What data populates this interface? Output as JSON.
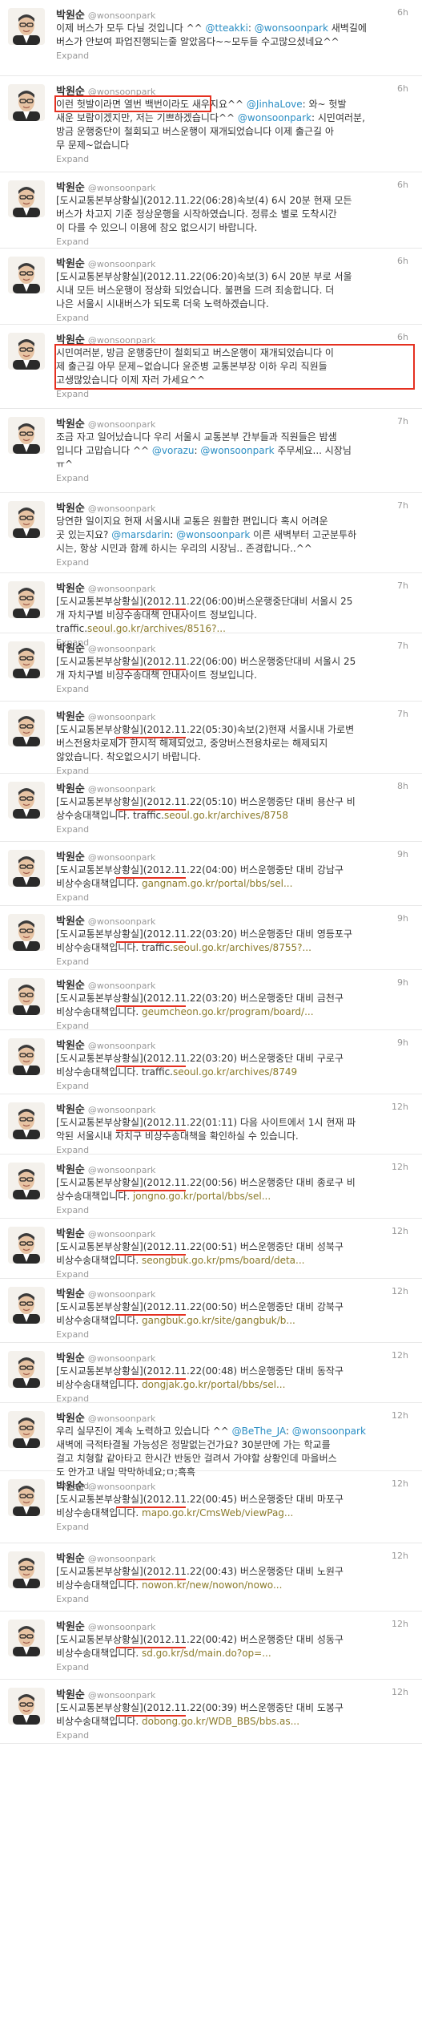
{
  "colors": {
    "link": "#2b8ec4",
    "url": "#8a7a2a",
    "highlight": "#e53020",
    "meta": "#999999"
  },
  "icons": {
    "avatar": "avatar-photo-icon"
  },
  "tweets": [
    {
      "name": "박원순",
      "handle": "@wonsoonpark",
      "time": "6h",
      "text_lines": [
        "이제 버스가 모두 다닐 것입니다 ^^ @tteakki: @wonsoonpark 새벽길에",
        "버스가 안보여 파업진행되는줄 알았음다~~모두들 수고많으셨네요^^"
      ],
      "expand": "Expand"
    },
    {
      "name": "박원순",
      "handle": "@wonsoonpark",
      "time": "6h",
      "text_lines": [
        "이런 헛발이라면 열번 백번이라도 새우지요^^ @JinhaLove: 와~ 헛발",
        "새운 보람이겠지만, 저는 기쁘하겠습니다^^ @wonsoonpark: 시민여러분,",
        "방금 운행중단이 철회되고 버스운행이 재개되었습니다 이제 출근길 아",
        "무 문제~없습니다"
      ],
      "expand": "Expand"
    },
    {
      "name": "박원순",
      "handle": "@wonsoonpark",
      "time": "6h",
      "text_lines": [
        "[도시교통본부상황실](2012.11.22(06:28)속보(4) 6시 20분 현재 모든",
        "버스가 차고지 기준 정상운행을 시작하였습니다. 정류소 별로 도착시간",
        "이 다를 수 있으니 이용에 참오 없으시기 바랍니다."
      ],
      "expand": "Expand"
    },
    {
      "name": "박원순",
      "handle": "@wonsoonpark",
      "time": "6h",
      "text_lines": [
        "[도시교통본부상황실](2012.11.22(06:20)속보(3) 6시 20분 부로 서울",
        "시내 모든 버스운행이 정상화 되었습니다. 불편을 드려 죄송합니다. 더",
        "나은 서울시 시내버스가 되도록 더욱 노력하겠습니다."
      ],
      "expand": "Expand"
    },
    {
      "name": "박원순",
      "handle": "@wonsoonpark",
      "time": "6h",
      "text_lines": [
        "시민여러분, 방금 운행중단이 철회되고 버스운행이 재개되었습니다 이",
        "제 출근길 아무 문제~없습니다 윤준병 교통본부장 이하 우리 직원들",
        "고생많았습니다 이제 자러 가세요^^"
      ],
      "expand": "Expand"
    },
    {
      "name": "박원순",
      "handle": "@wonsoonpark",
      "time": "7h",
      "text_lines": [
        "조금 자고 일어났습니다 우리 서울시 교통본부 간부들과 직원들은 밤샘",
        "입니다 고맙습니다 ^^ @vorazu: @wonsoonpark 주무세요... 시장님",
        "ㅠ^"
      ],
      "expand": "Expand"
    },
    {
      "name": "박원순",
      "handle": "@wonsoonpark",
      "time": "7h",
      "text_lines": [
        "당연한 일이지요 현재 서울시내 교통은 원활한 편입니다 혹시 어려운",
        "곳 있는지요? @marsdarin: @wonsoonpark 이른 새벽부터 고군분투하",
        "시는, 항상 시민과 함께 하시는 우리의 시장님.. 존경합니다..^^"
      ],
      "expand": "Expand"
    },
    {
      "name": "박원순",
      "handle": "@wonsoonpark",
      "time": "7h",
      "text_lines": [
        "[도시교통본부상황실](2012.11.22(06:00)버스운행중단대비 서울시 25",
        "개 자치구별 비상수송대책 안내사이트 정보입니다.",
        "traffic.seoul.go.kr/archives/8516?..."
      ],
      "expand": "Expand"
    },
    {
      "name": "박원순",
      "handle": "@wonsoonpark",
      "time": "7h",
      "text_lines": [
        "[도시교통본부상황실](2012.11.22(06:00) 버스운행중단대비 서울시 25",
        "개 자치구별 비상수송대책 안내사이트 정보입니다."
      ],
      "expand": "Expand"
    },
    {
      "name": "박원순",
      "handle": "@wonsoonpark",
      "time": "7h",
      "text_lines": [
        "[도시교통본부상황실](2012.11.22(05:30)속보(2)현재 서울시내 가로변",
        "버스전용차로제가 한시적 해제되었고, 중앙버스전용차로는 해제되지",
        "않았습니다. 착오없으시기 바랍니다."
      ],
      "expand": "Expand"
    },
    {
      "name": "박원순",
      "handle": "@wonsoonpark",
      "time": "8h",
      "text_lines": [
        "[도시교통본부상황실](2012.11.22(05:10) 버스운행중단 대비 용산구 비",
        "상수송대책입니다. traffic.seoul.go.kr/archives/8758"
      ],
      "expand": "Expand"
    },
    {
      "name": "박원순",
      "handle": "@wonsoonpark",
      "time": "9h",
      "text_lines": [
        "[도시교통본부상황실](2012.11.22(04:00) 버스운행중단 대비 강남구",
        "비상수송대책입니다. gangnam.go.kr/portal/bbs/sel..."
      ],
      "expand": "Expand"
    },
    {
      "name": "박원순",
      "handle": "@wonsoonpark",
      "time": "9h",
      "text_lines": [
        "[도시교통본부상황실](2012.11.22(03:20) 버스운행중단 대비 영등포구",
        "비상수송대책입니다. traffic.seoul.go.kr/archives/8755?..."
      ],
      "expand": "Expand"
    },
    {
      "name": "박원순",
      "handle": "@wonsoonpark",
      "time": "9h",
      "text_lines": [
        "[도시교통본부상황실](2012.11.22(03:20) 버스운행중단 대비 금천구",
        "비상수송대책입니다. geumcheon.go.kr/program/board/..."
      ],
      "expand": "Expand"
    },
    {
      "name": "박원순",
      "handle": "@wonsoonpark",
      "time": "9h",
      "text_lines": [
        "[도시교통본부상황실](2012.11.22(03:20) 버스운행중단 대비 구로구",
        "비상수송대책입니다. traffic.seoul.go.kr/archives/8749"
      ],
      "expand": "Expand"
    },
    {
      "name": "박원순",
      "handle": "@wonsoonpark",
      "time": "12h",
      "text_lines": [
        "[도시교통본부상황실](2012.11.22(01:11) 다음 사이트에서 1시 현재 파",
        "악된 서울시내 자치구 비상수송대책을 확인하실 수 있습니다."
      ],
      "expand": "Expand"
    },
    {
      "name": "박원순",
      "handle": "@wonsoonpark",
      "time": "12h",
      "text_lines": [
        "[도시교통본부상황실](2012.11.22(00:56) 버스운행중단 대비 종로구 비",
        "상수송대책입니다. jongno.go.kr/portal/bbs/sel..."
      ],
      "expand": "Expand"
    },
    {
      "name": "박원순",
      "handle": "@wonsoonpark",
      "time": "12h",
      "text_lines": [
        "[도시교통본부상황실](2012.11.22(00:51) 버스운행중단 대비 성북구",
        "비상수송대책입니다. seongbuk.go.kr/pms/board/deta..."
      ],
      "expand": "Expand"
    },
    {
      "name": "박원순",
      "handle": "@wonsoonpark",
      "time": "12h",
      "text_lines": [
        "[도시교통본부상황실](2012.11.22(00:50) 버스운행중단 대비 강북구",
        "비상수송대책입니다. gangbuk.go.kr/site/gangbuk/b..."
      ],
      "expand": "Expand"
    },
    {
      "name": "박원순",
      "handle": "@wonsoonpark",
      "time": "12h",
      "text_lines": [
        "[도시교통본부상황실](2012.11.22(00:48) 버스운행중단 대비 동작구",
        "비상수송대책입니다. dongjak.go.kr/portal/bbs/sel..."
      ],
      "expand": "Expand"
    },
    {
      "name": "박원순",
      "handle": "@wonsoonpark",
      "time": "12h",
      "text_lines": [
        "우리 실무진이 계속 노력하고 있습니다 ^^ @BeThe_JA: @wonsoonpark",
        "새벽에 극적타결될 가능성은 정말없는건가요? 30분만에 가는 학교를",
        "걸고 치형할 같아타고 한시간 반동안 걸려서 가야할 상황인데 마을버스",
        "도 안가고 내일 막막하네요;ㅁ;흑흑"
      ],
      "expand": "Expand"
    },
    {
      "name": "박원순",
      "handle": "@wonsoonpark",
      "time": "12h",
      "text_lines": [
        "[도시교통본부상황실](2012.11.22(00:45) 버스운행중단 대비 마포구",
        "비상수송대책입니다. mapo.go.kr/CmsWeb/viewPag..."
      ],
      "expand": "Expand"
    },
    {
      "name": "박원순",
      "handle": "@wonsoonpark",
      "time": "12h",
      "text_lines": [
        "[도시교통본부상황실](2012.11.22(00:43) 버스운행중단 대비 노원구",
        "비상수송대책입니다. nowon.kr/new/nowon/nowo..."
      ],
      "expand": "Expand"
    },
    {
      "name": "박원순",
      "handle": "@wonsoonpark",
      "time": "12h",
      "text_lines": [
        "[도시교통본부상황실](2012.11.22(00:42) 버스운행중단 대비 성동구",
        "비상수송대책입니다. sd.go.kr/sd/main.do?op=..."
      ],
      "expand": "Expand"
    },
    {
      "name": "박원순",
      "handle": "@wonsoonpark",
      "time": "12h",
      "text_lines": [
        "[도시교통본부상황실](2012.11.22(00:39) 버스운행중단 대비 도봉구",
        "비상수송대책입니다. dobong.go.kr/WDB_BBS/bbs.as..."
      ],
      "expand": "Expand"
    }
  ]
}
